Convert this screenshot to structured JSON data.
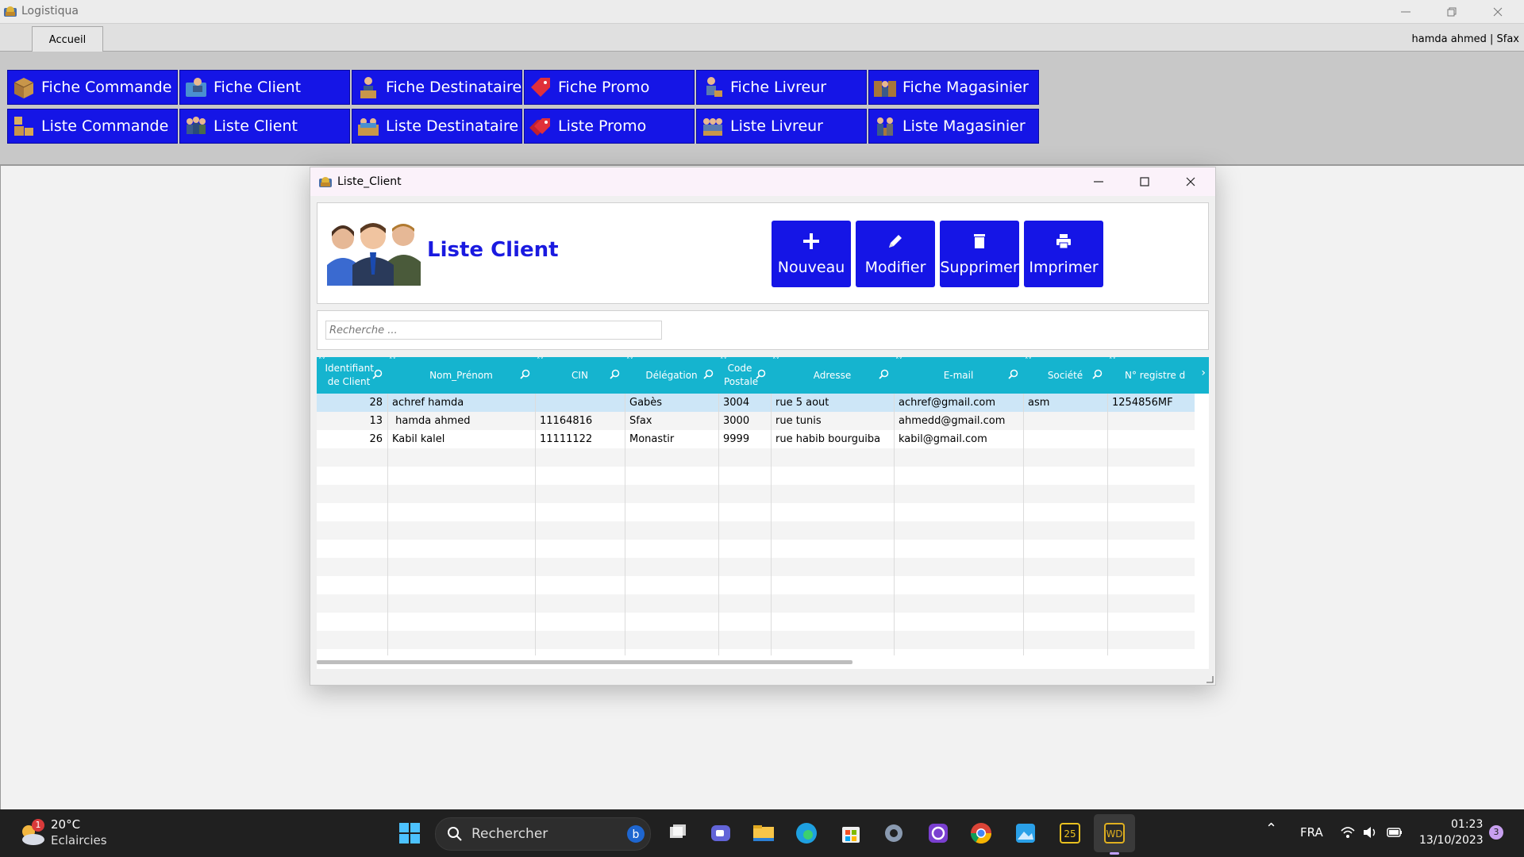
{
  "app": {
    "title": "Logistiqua",
    "tab": "Accueil",
    "user": "hamda ahmed | Sfax"
  },
  "ribbon": {
    "row1": [
      "Fiche Commande",
      "Fiche Client",
      "Fiche Destinataire",
      "Fiche Promo",
      "Fiche Livreur",
      "Fiche Magasinier"
    ],
    "row2": [
      "Liste Commande",
      "Liste Client",
      "Liste Destinataire",
      "Liste Promo",
      "Liste Livreur",
      "Liste Magasinier"
    ]
  },
  "window": {
    "title": "Liste_Client",
    "header_title": "Liste Client",
    "buttons": [
      "Nouveau",
      "Modifier",
      "Supprimer",
      "Imprimer"
    ],
    "search_placeholder": "Recherche ..."
  },
  "table": {
    "columns": [
      "Identifiant de Client",
      "Nom_Prénom",
      "CIN",
      "Délégation",
      "Code Postale",
      "Adresse",
      "E-mail",
      "Société",
      "N° registre d"
    ],
    "rows": [
      {
        "id": "28",
        "nom": "achref hamda",
        "cin": "",
        "delegation": "Gabès",
        "cp": "3004",
        "adresse": "rue  5 aout",
        "email": "achref@gmail.com",
        "societe": "asm",
        "registre": "1254856MF"
      },
      {
        "id": "13",
        "nom": " hamda ahmed",
        "cin": "11164816",
        "delegation": "Sfax",
        "cp": "3000",
        "adresse": "rue tunis",
        "email": "ahmedd@gmail.com",
        "societe": "",
        "registre": ""
      },
      {
        "id": "26",
        "nom": "Kabil kalel",
        "cin": "11111122",
        "delegation": "Monastir",
        "cp": "9999",
        "adresse": "rue habib bourguiba",
        "email": "kabil@gmail.com",
        "societe": "",
        "registre": ""
      }
    ],
    "selected_row": 0
  },
  "taskbar": {
    "weather_temp": "20°C",
    "weather_desc": "Eclaircies",
    "weather_badge": "1",
    "search_label": "Rechercher",
    "language": "FRA",
    "time": "01:23",
    "date": "13/10/2023",
    "notif_count": "3"
  },
  "colors": {
    "ribbon_button": "#1515e6",
    "table_header": "#15b4cf",
    "selected_row": "#cde6f7",
    "header_title": "#1a1ae0"
  }
}
